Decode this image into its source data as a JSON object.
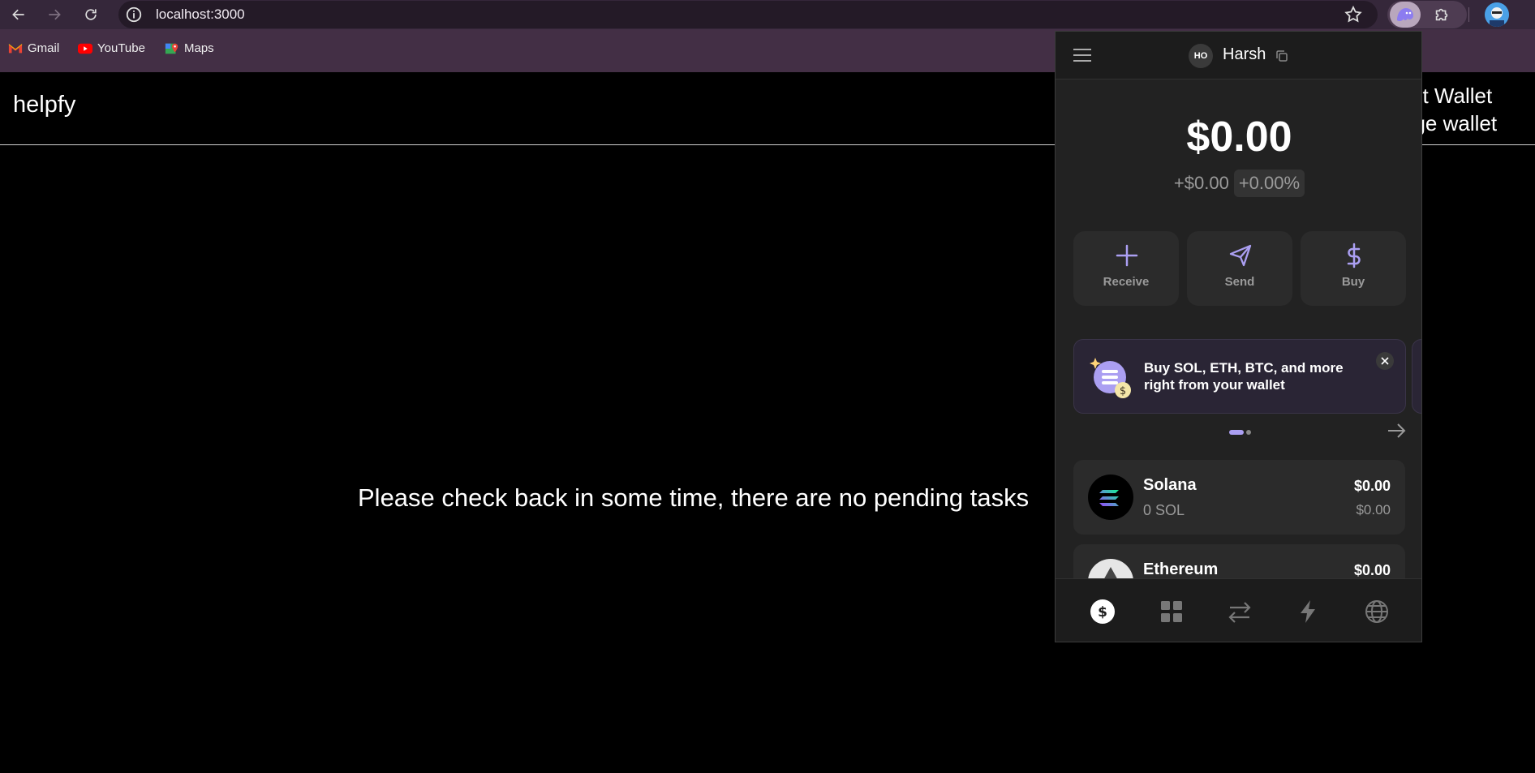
{
  "browser": {
    "url": "localhost:3000",
    "bookmarks": [
      {
        "label": "Gmail",
        "icon": "gmail-icon"
      },
      {
        "label": "YouTube",
        "icon": "youtube-icon"
      },
      {
        "label": "Maps",
        "icon": "maps-icon"
      }
    ]
  },
  "page": {
    "logo": "helpfy",
    "connect_wallet_label": "ect Wallet",
    "change_wallet_label": "nge wallet",
    "message": "Please check back in some time, there are no pending tasks"
  },
  "wallet": {
    "account_initials": "HO",
    "account_name": "Harsh",
    "balance": "$0.00",
    "change_abs": "+$0.00",
    "change_pct": "+0.00%",
    "actions": [
      {
        "label": "Receive",
        "icon": "plus-icon"
      },
      {
        "label": "Send",
        "icon": "send-icon"
      },
      {
        "label": "Buy",
        "icon": "dollar-icon"
      }
    ],
    "promo": {
      "text": "Buy SOL, ETH, BTC, and more right from your wallet",
      "page": 1,
      "pages": 2
    },
    "tokens": [
      {
        "name": "Solana",
        "amount": "0 SOL",
        "value": "$0.00",
        "usd": "$0.00"
      },
      {
        "name": "Ethereum",
        "amount": "",
        "value": "$0.00",
        "usd": ""
      }
    ],
    "tabs": [
      "tokens-tab",
      "collectibles-tab",
      "swap-tab",
      "activity-tab",
      "explore-tab"
    ],
    "active_tab": "tokens-tab",
    "accent_color": "#ab9ff2"
  }
}
